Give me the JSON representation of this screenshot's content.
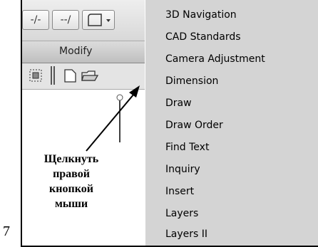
{
  "page_number": "7",
  "toolbar": {
    "btn1_text": "-/-",
    "btn2_text": "--/",
    "modify_label": "Modify"
  },
  "annotation": {
    "lines": [
      "Щелкнуть",
      "правой",
      "кнопкой",
      "мыши"
    ]
  },
  "menu": {
    "items": [
      "3D Navigation",
      "CAD Standards",
      "Camera Adjustment",
      "Dimension",
      "Draw",
      "Draw Order",
      "Find Text",
      "Inquiry",
      "Insert",
      "Layers",
      "Layers II"
    ]
  },
  "colors": {
    "menu_bg": "#d4d4d4",
    "toolbar_bg": "#e4e4e4"
  }
}
